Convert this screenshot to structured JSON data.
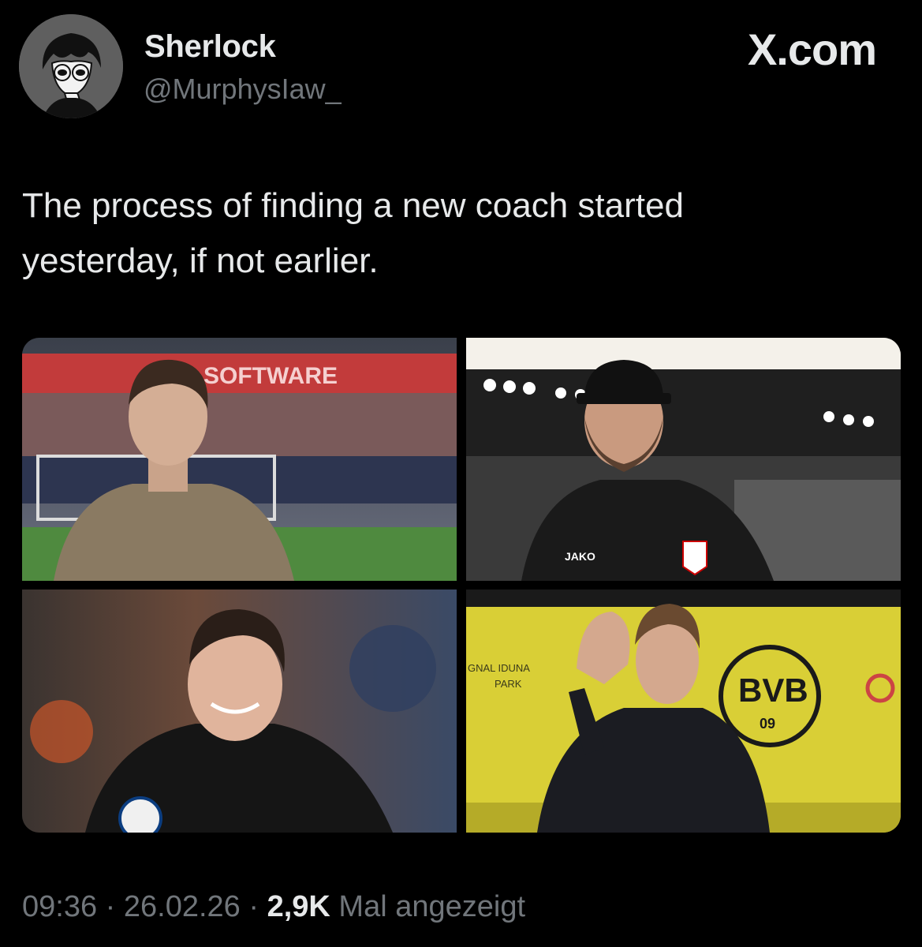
{
  "post": {
    "author": {
      "display_name": "Sherlock",
      "handle": "@MurphysIaw_",
      "avatar_icon": "anime-detective-avatar"
    },
    "brand": "X.com",
    "text_line1": "The process of finding a new coach started",
    "text_line2": "yesterday, if not earlier.",
    "media": [
      {
        "description_icon": "coach-photo-icon",
        "sign_text": "SOFTWARE"
      },
      {
        "description_icon": "coach-photo-icon",
        "sponsor_text": "JAKO"
      },
      {
        "description_icon": "coach-photo-icon"
      },
      {
        "description_icon": "coach-photo-icon",
        "sign_text": "GNAL IDUNA",
        "sign_text2": "PARK",
        "badge_text": "BVB",
        "badge_number": "09"
      }
    ],
    "meta": {
      "time": "09:36",
      "separator": " · ",
      "date": "26.02.26",
      "views_count": "2,9K",
      "views_label": "Mal angezeigt"
    }
  },
  "colors": {
    "background": "#000000",
    "primary_text": "#e7e9ea",
    "secondary_text": "#71767b"
  }
}
